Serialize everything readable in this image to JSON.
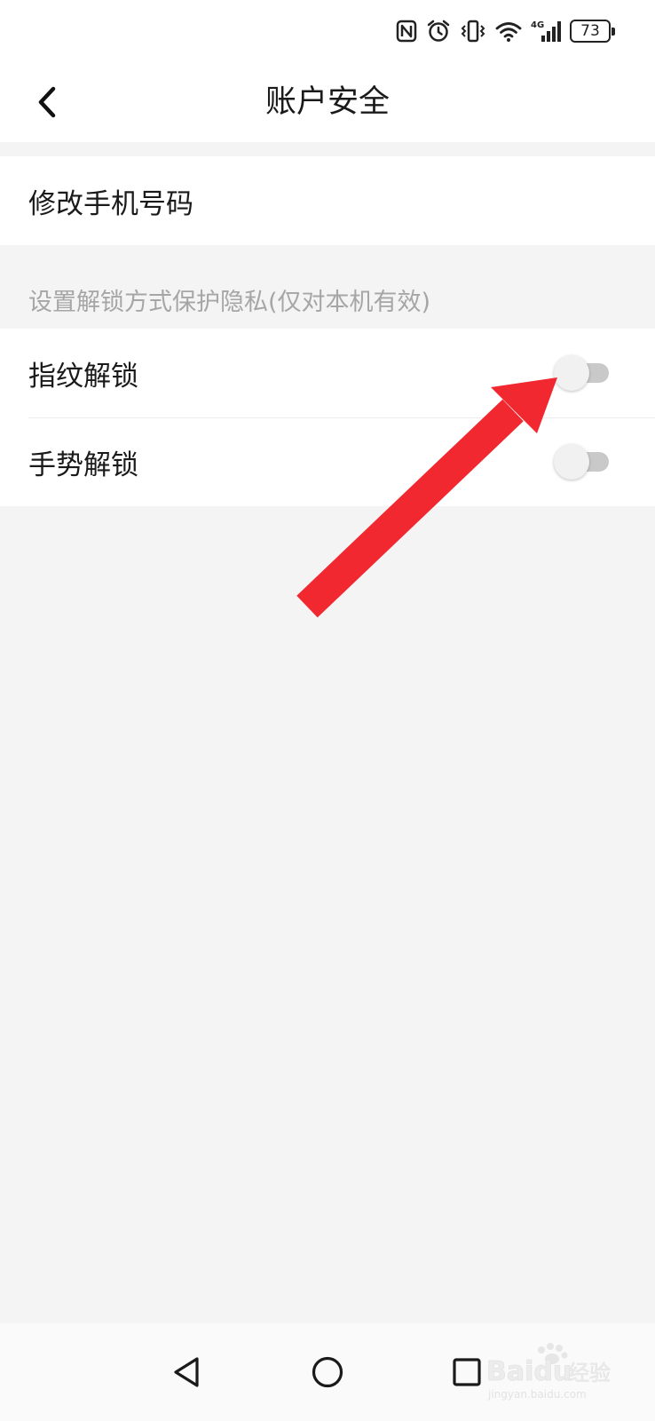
{
  "status_bar": {
    "battery_level": "73",
    "network_label": "4G"
  },
  "header": {
    "title": "账户安全"
  },
  "account_section": {
    "items": [
      {
        "label": "修改手机号码"
      }
    ]
  },
  "unlock_section": {
    "header": "设置解锁方式保护隐私(仅对本机有效)",
    "items": [
      {
        "label": "指纹解锁",
        "enabled": false
      },
      {
        "label": "手势解锁",
        "enabled": false
      }
    ]
  },
  "annotation": {
    "arrow_color": "#f1282f"
  },
  "watermark": {
    "brand": "Bai",
    "brand_suffix": "du",
    "brand_cn": "经验",
    "site": "jingyan.baidu.com"
  }
}
